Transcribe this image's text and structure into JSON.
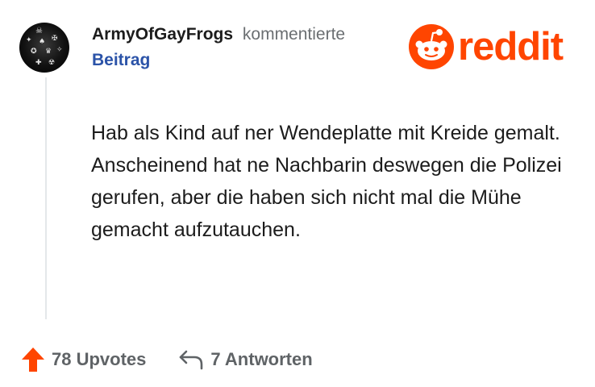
{
  "comment": {
    "username": "ArmyOfGayFrogs",
    "action": "kommentierte",
    "target": "Beitrag",
    "body": "Hab als Kind auf ner Wendeplatte mit Kreide gemalt. Anscheinend hat ne Nachbarin deswegen die Polizei gerufen, aber die haben sich nicht mal die Mühe gemacht aufzutauchen."
  },
  "brand": {
    "wordmark": "reddit",
    "color": "#ff4500"
  },
  "footer": {
    "upvotes_label": "78 Upvotes",
    "replies_label": "7 Antworten"
  },
  "icons": {
    "upvote": "upvote-arrow-icon",
    "reply": "reply-arrow-icon",
    "logo": "snoo-icon"
  }
}
